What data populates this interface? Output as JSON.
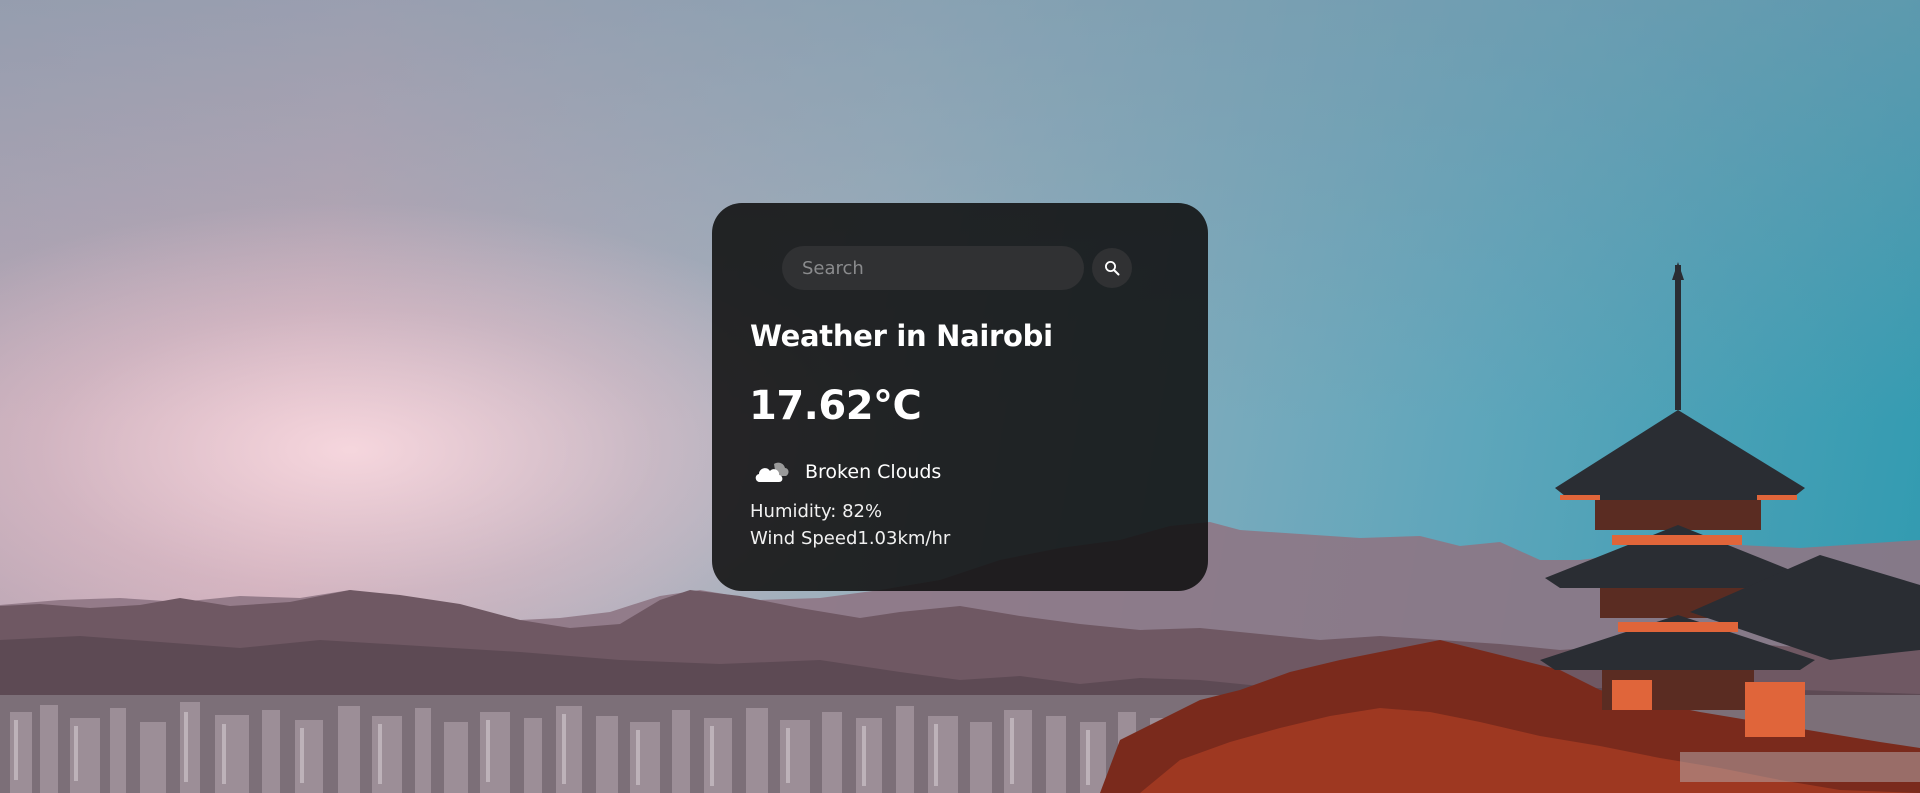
{
  "search": {
    "placeholder": "Search",
    "value": "",
    "button_icon": "search-icon"
  },
  "weather": {
    "title": "Weather in Nairobi",
    "temperature": "17.62°C",
    "icon": "broken-clouds-icon",
    "description": "Broken Clouds",
    "humidity": "Humidity: 82%",
    "wind": "Wind Speed1.03km/hr"
  },
  "colors": {
    "card_background": "#101010",
    "input_background": "#303133",
    "text": "#ffffff"
  }
}
